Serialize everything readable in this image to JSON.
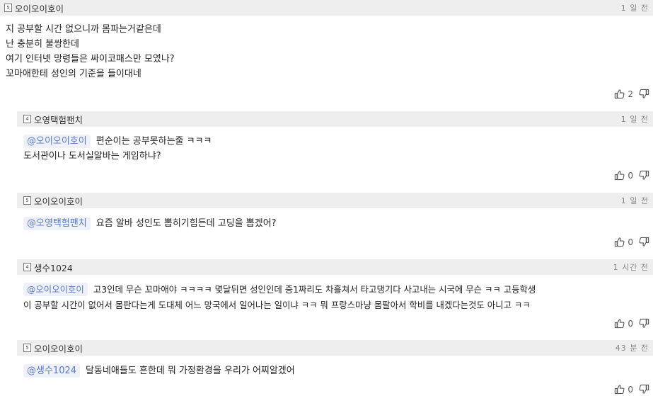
{
  "comments": [
    {
      "nick": "오이오이호이",
      "level": "5",
      "time": "1 일 전",
      "lines": [
        "지 공부할 시간 없으니까 몸파는거같은데",
        "난 충분히 불쌍한데",
        "여기 인터넷 망령들은 싸이코패스만 모였나?",
        "꼬마애한테 성인의 기준을 들이대네"
      ],
      "likes": "2"
    },
    {
      "nick": "오영택험팬치",
      "level": "4",
      "time": "1 일 전",
      "mention": "@오이오이호이",
      "lines": [
        "편순이는 공부못하는줄 ㅋㅋㅋ",
        "도서관이나 도서실알바는 게임하냐?"
      ],
      "likes": "0"
    },
    {
      "nick": "오이오이호이",
      "level": "5",
      "time": "1 일 전",
      "mention": "@오영택험팬치",
      "lines": [
        "요즘 알바 성인도 뽑히기힘든데 고딩을 뽑겠어?"
      ],
      "likes": "0"
    },
    {
      "nick": "생수1024",
      "level": "4",
      "time": "1 시간 전",
      "mention": "@오이오이호이",
      "lines": [
        "고3인데 무슨 꼬마애야 ㅋㅋㅋㅋ 몇달뒤면 성인인데 중1짜리도 차흘쳐서 타고댕기다 사고내는 시국에 무슨 ㅋㅋ 고등학생",
        "이 공부할 시간이 없어서 몸판다는게 도대체 어느 망국에서 일어나는 일이냐 ㅋㅋ 뭐 프랑스마냥 몸팔아서 학비를 내겠다는것도 아니고 ㅋㅋ"
      ],
      "likes": "0"
    },
    {
      "nick": "오이오이호이",
      "level": "5",
      "time": "43 분 전",
      "mention": "@생수1024",
      "lines": [
        "달동네애들도 흔한데 뭐 가정환경을 우리가 어찌알겠어"
      ],
      "likes": "0"
    }
  ]
}
